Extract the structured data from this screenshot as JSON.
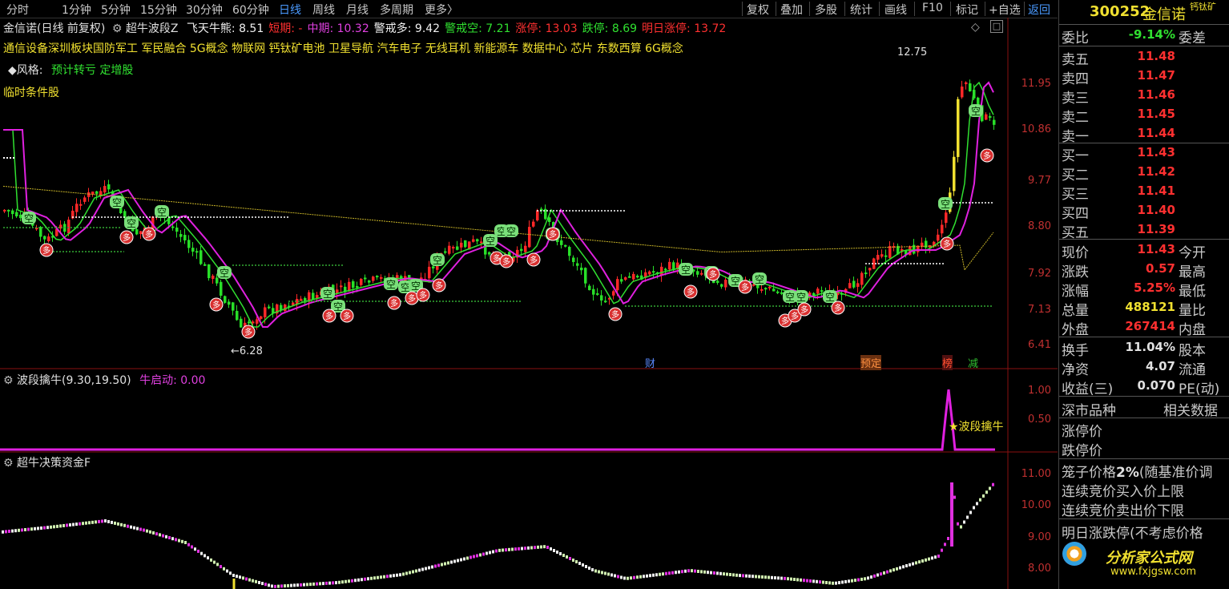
{
  "toolbar": {
    "periods": [
      "分时",
      "1分钟",
      "5分钟",
      "15分钟",
      "30分钟",
      "60分钟",
      "日线",
      "周线",
      "月线",
      "多周期",
      "更多"
    ],
    "active_period": "日线",
    "more_arrow": "〉",
    "actions": [
      "复权",
      "叠加",
      "多股",
      "统计",
      "画线",
      "F10",
      "标记",
      "+自选",
      "返回"
    ],
    "return_label": "返回"
  },
  "chart": {
    "title_line": {
      "stock": "金信诺(日线 前复权)",
      "indicator": "超牛波段Z",
      "items": [
        {
          "label": "飞天牛熊: ",
          "value": "8.51",
          "color": "#f0f0f0"
        },
        {
          "label": "短期: ",
          "value": "-",
          "color": "#ff3030"
        },
        {
          "label": "中期: ",
          "value": "10.32",
          "color": "#e040e0"
        },
        {
          "label": "警戒多: ",
          "value": "9.42",
          "color": "#f0f0f0"
        },
        {
          "label": "警戒空: ",
          "value": "7.21",
          "color": "#30e030"
        },
        {
          "label": "涨停: ",
          "value": "13.03",
          "color": "#ff3030"
        },
        {
          "label": "跌停: ",
          "value": "8.69",
          "color": "#30e030"
        },
        {
          "label": "明日涨停: ",
          "value": "13.72",
          "color": "#ff3030"
        }
      ]
    },
    "concepts": "通信设备深圳板块国防军工 军民融合 5G概念 物联网 钙钛矿电池 卫星导航 汽车电子 无线耳机 新能源车 数据中心 芯片 东数西算 6G概念",
    "style_label": "◆风格:",
    "style_value": "预计转亏 定增股",
    "temp_label": "临时条件股",
    "high_marker": "12.75",
    "low_marker": "←6.28",
    "price_axis": [
      "11.95",
      "10.86",
      "9.77",
      "8.80",
      "7.92",
      "7.13",
      "6.41"
    ],
    "event_tags": [
      {
        "label": "财",
        "color": "#5a8aff"
      },
      {
        "label": "预定",
        "color": "#ff9040"
      },
      {
        "label": "榜",
        "color": "#ff5030"
      },
      {
        "label": "减",
        "color": "#30c030"
      }
    ],
    "signal_kong": "空",
    "signal_duo": "多",
    "sub1": {
      "name": "波段擒牛(9.30,19.50)",
      "item_label": "牛启动: ",
      "item_value": "0.00",
      "axis": [
        "1.00",
        "0.50"
      ],
      "annotation": "★波段擒牛"
    },
    "sub2": {
      "name": "超牛决策资金F",
      "axis": [
        "11.00",
        "10.00",
        "9.00",
        "8.00"
      ]
    }
  },
  "panel": {
    "code": "300252",
    "name": "金信诺",
    "concept": "钙钛矿",
    "weibi_label": "委比",
    "weibi_value": "-9.14%",
    "weicha_label": "委差",
    "sell": [
      {
        "label": "卖五",
        "price": "11.48"
      },
      {
        "label": "卖四",
        "price": "11.47"
      },
      {
        "label": "卖三",
        "price": "11.46"
      },
      {
        "label": "卖二",
        "price": "11.45"
      },
      {
        "label": "卖一",
        "price": "11.44"
      }
    ],
    "buy": [
      {
        "label": "买一",
        "price": "11.43"
      },
      {
        "label": "买二",
        "price": "11.42"
      },
      {
        "label": "买三",
        "price": "11.41"
      },
      {
        "label": "买四",
        "price": "11.40"
      },
      {
        "label": "买五",
        "price": "11.39"
      }
    ],
    "quote": [
      {
        "label": "现价",
        "value": "11.43",
        "color": "#ff3030",
        "label2": "今开"
      },
      {
        "label": "涨跌",
        "value": "0.57",
        "color": "#ff3030",
        "label2": "最高"
      },
      {
        "label": "涨幅",
        "value": "5.25%",
        "color": "#ff3030",
        "label2": "最低"
      },
      {
        "label": "总量",
        "value": "488121",
        "color": "#f0e030",
        "label2": "量比"
      },
      {
        "label": "外盘",
        "value": "267414",
        "color": "#ff3030",
        "label2": "内盘"
      }
    ],
    "fund": [
      {
        "label": "换手",
        "value": "11.04%",
        "label2": "股本"
      },
      {
        "label": "净资",
        "value": "4.07",
        "label2": "流通"
      },
      {
        "label": "收益(三)",
        "value": "0.070",
        "label2": "PE(动)"
      }
    ],
    "market_label": "深市品种",
    "related_label": "相关数据",
    "limit_up": "涨停价",
    "limit_down": "跌停价",
    "cage_label": "笼子价格",
    "cage_value": "2%",
    "cage_suffix": "(随基准价调",
    "bid_up": "连续竞价买入价上限",
    "bid_down": "连续竞价卖出价下限",
    "tomorrow": "明日涨跌停(不考虑价格",
    "watermark_cn": "分析家公式网",
    "watermark_url": "www.fxjgsw.com"
  },
  "colors": {
    "up": "#ff2828",
    "down": "#28e028",
    "ma_purple": "#e020e0",
    "ma_green": "#30e030",
    "ma_yellow": "#c8b428"
  }
}
